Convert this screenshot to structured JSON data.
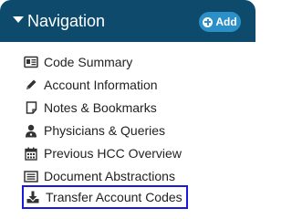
{
  "header": {
    "title": "Navigation",
    "add_label": "Add"
  },
  "nav": {
    "items": [
      {
        "label": "Code Summary",
        "icon": "id-card-icon"
      },
      {
        "label": "Account Information",
        "icon": "pencil-icon"
      },
      {
        "label": "Notes & Bookmarks",
        "icon": "note-icon"
      },
      {
        "label": "Physicians & Queries",
        "icon": "doctor-icon"
      },
      {
        "label": "Previous HCC Overview",
        "icon": "calendar-icon"
      },
      {
        "label": "Document Abstractions",
        "icon": "list-box-icon"
      },
      {
        "label": "Transfer Account Codes",
        "icon": "download-icon",
        "selected": true
      }
    ]
  },
  "colors": {
    "header_bg": "#0e4a6c",
    "add_button_bg": "#2b8fc8",
    "selected_outline": "#1a1adb"
  }
}
